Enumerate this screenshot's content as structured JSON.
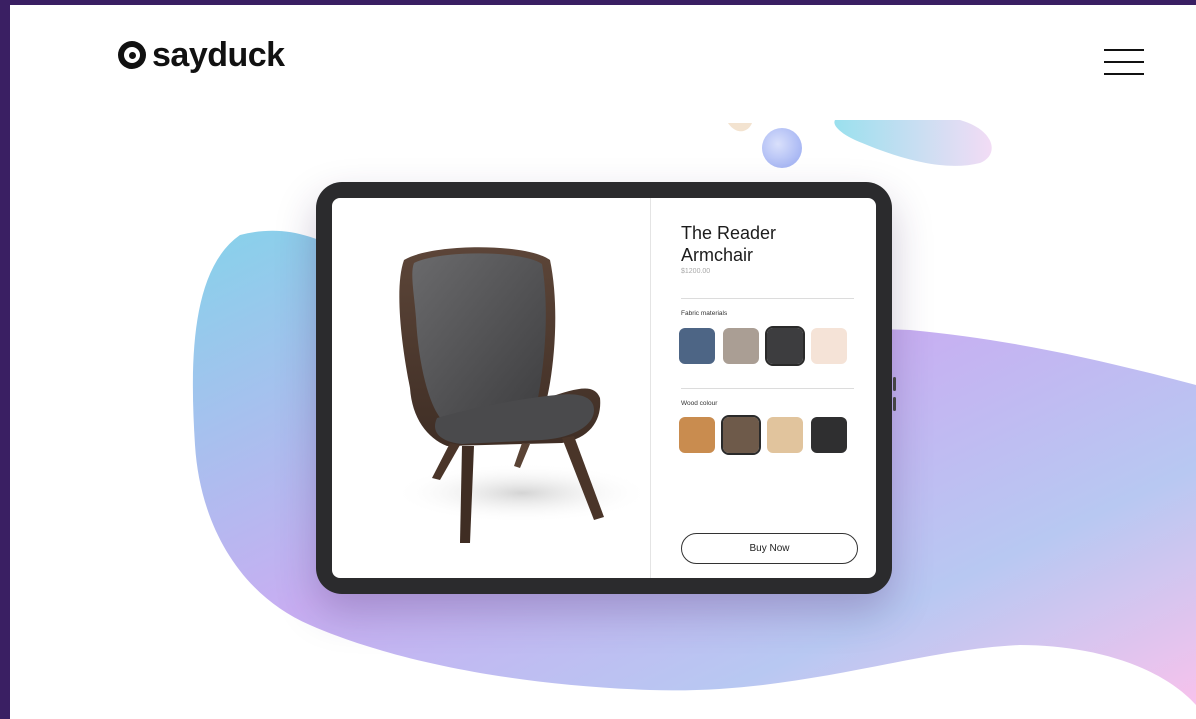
{
  "header": {
    "brand": "sayduck",
    "logo_icon": "sayduck-duck-logo",
    "menu_icon": "hamburger-menu-icon"
  },
  "product": {
    "title_line1": "The Reader",
    "title_line2": "Armchair",
    "price": "$1200.00",
    "fabric_label": "Fabric materials",
    "fabric_swatches": [
      {
        "name": "blue",
        "color": "#4d6585"
      },
      {
        "name": "taupe",
        "color": "#aa9e94"
      },
      {
        "name": "charcoal",
        "color": "#3d3d3f",
        "selected": true
      },
      {
        "name": "blush",
        "color": "#f5e3d7"
      }
    ],
    "wood_label": "Wood colour",
    "wood_swatches": [
      {
        "name": "oak",
        "color": "#c98c4f"
      },
      {
        "name": "walnut",
        "color": "#6e5a4a",
        "selected": true
      },
      {
        "name": "birch",
        "color": "#e1c49d"
      },
      {
        "name": "black",
        "color": "#2f2f30"
      }
    ],
    "buy_label": "Buy Now"
  },
  "colors": {
    "frame": "#3a1f63",
    "gradient_cyan": "#8fd3ea",
    "gradient_purple": "#c9a4f0",
    "gradient_pink": "#f7c6ee"
  }
}
